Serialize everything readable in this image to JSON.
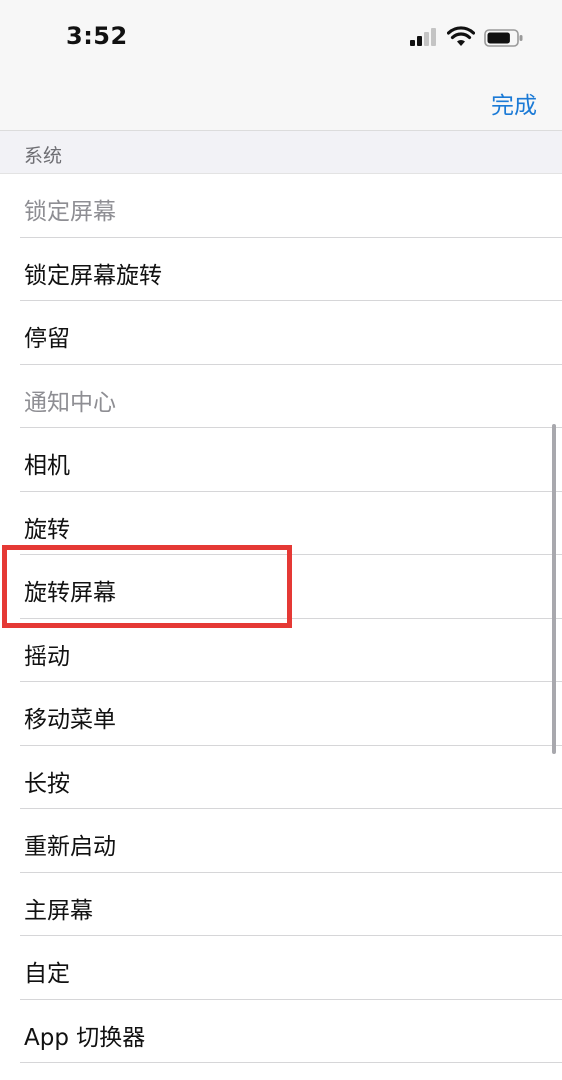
{
  "status_bar": {
    "time": "3:52",
    "signal_bars_active": 2,
    "signal_bars_total": 4,
    "wifi_icon": "wifi-icon",
    "battery_icon": "battery-icon",
    "battery_level": 0.8
  },
  "nav": {
    "done_label": "完成",
    "accent_color": "#1b7ad6"
  },
  "section": {
    "title": "系统"
  },
  "items": [
    {
      "label": "锁定屏幕",
      "disabled": true
    },
    {
      "label": "锁定屏幕旋转",
      "disabled": false
    },
    {
      "label": "停留",
      "disabled": false
    },
    {
      "label": "通知中心",
      "disabled": true
    },
    {
      "label": "相机",
      "disabled": false
    },
    {
      "label": "旋转",
      "disabled": false
    },
    {
      "label": "旋转屏幕",
      "disabled": false,
      "highlighted": true
    },
    {
      "label": "摇动",
      "disabled": false
    },
    {
      "label": "移动菜单",
      "disabled": false
    },
    {
      "label": "长按",
      "disabled": false
    },
    {
      "label": "重新启动",
      "disabled": false
    },
    {
      "label": "主屏幕",
      "disabled": false
    },
    {
      "label": "自定",
      "disabled": false
    },
    {
      "label": "App 切换器",
      "disabled": false
    }
  ],
  "highlight_color": "#e53935"
}
